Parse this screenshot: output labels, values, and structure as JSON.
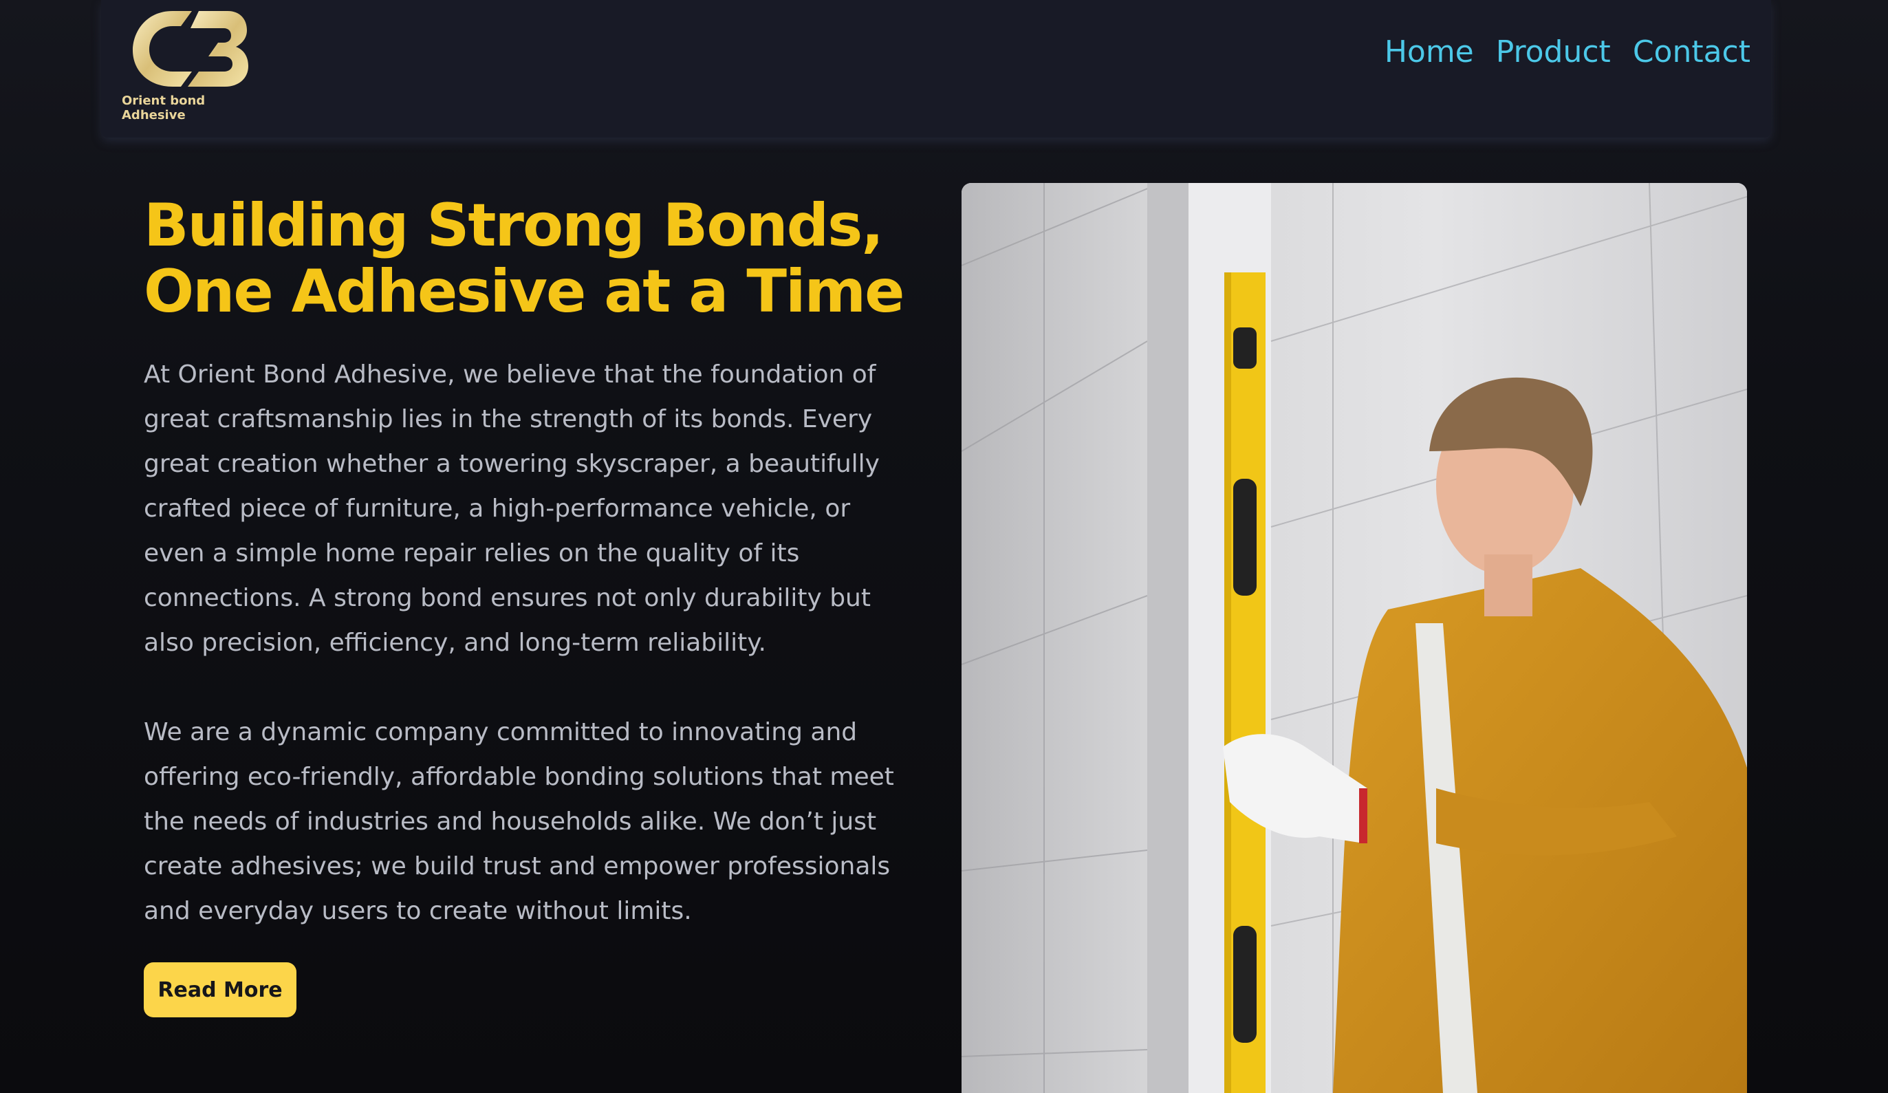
{
  "header": {
    "logo_text": "Orient bond Adhesive",
    "nav": [
      {
        "label": "Home"
      },
      {
        "label": "Product"
      },
      {
        "label": "Contact"
      }
    ]
  },
  "hero": {
    "title_line1": "Building Strong Bonds,",
    "title_line2": "One Adhesive at a Time",
    "paragraph1": "At Orient Bond Adhesive, we believe that the foundation of great craftsmanship lies in the strength of its bonds. Every great creation whether a towering skyscraper, a beautifully crafted piece of furniture, a high-performance vehicle, or even a simple home repair relies on the quality of its connections. A strong bond ensures not only durability but also precision, efficiency, and long-term reliability.",
    "paragraph2": "We are a dynamic company committed to innovating and offering eco-friendly, affordable bonding solutions that meet the needs of industries and households alike. We don’t just create adhesives; we build trust and empower professionals and everyday users to create without limits.",
    "cta_label": "Read More",
    "image_icon": "woman-with-spirit-level-photo"
  },
  "colors": {
    "accent_yellow": "#f5c518",
    "nav_link": "#4cc8e8",
    "button_bg": "#fcd54a",
    "background": "#0f1015"
  }
}
